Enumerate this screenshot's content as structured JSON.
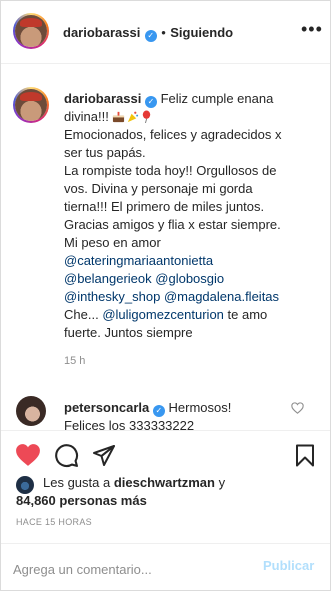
{
  "header": {
    "username": "dariobarassi",
    "separator": "•",
    "follow_status": "Siguiendo",
    "more_icon": "more-horizontal-icon"
  },
  "post": {
    "author": "dariobarassi",
    "caption_lines": [
      "Feliz cumple enana",
      "divina!!!",
      "Emocionados, felices y agradecidos x",
      "ser tus papás.",
      "La rompiste toda hoy!! Orgullosos de",
      "vos. Divina y personaje mi gorda",
      "tierna!!! El primero de miles juntos.",
      "Gracias amigos y flia x estar siempre.",
      "Mi peso en amor"
    ],
    "emoji_icons": [
      "cake-icon",
      "party-popper-icon",
      "balloon-icon"
    ],
    "mentions": {
      "m1": "@cateringmariaantonietta",
      "m2": "@belangerieok",
      "m3": "@globosgio",
      "m4": "@inthesky_shop",
      "m5": "@magdalena.fleitas",
      "m6": "@luligomezcenturion"
    },
    "tail": {
      "che": "Che...",
      "te_amo": " te amo",
      "last": "fuerte. Juntos siempre"
    },
    "time_ago": "15 h"
  },
  "comment": {
    "username": "petersoncarla",
    "line1": "Hermosos!",
    "line2": "Felices los 333333222"
  },
  "actions": {
    "like_icon": "heart-filled-icon",
    "comment_icon": "comment-icon",
    "share_icon": "share-icon",
    "save_icon": "bookmark-icon",
    "like_color": "#ed4956"
  },
  "likes": {
    "prefix": "Les gusta a ",
    "user": "dieschwartzman",
    "conj": " y",
    "count": "84,860 personas más"
  },
  "posted_ago": "HACE 15 HORAS",
  "compose": {
    "placeholder": "Agrega un comentario...",
    "publish_label": "Publicar"
  },
  "colors": {
    "verified": "#3897f0",
    "mention": "#00376b",
    "muted": "#8e8e8e",
    "publish_disabled": "#b2dffc"
  }
}
